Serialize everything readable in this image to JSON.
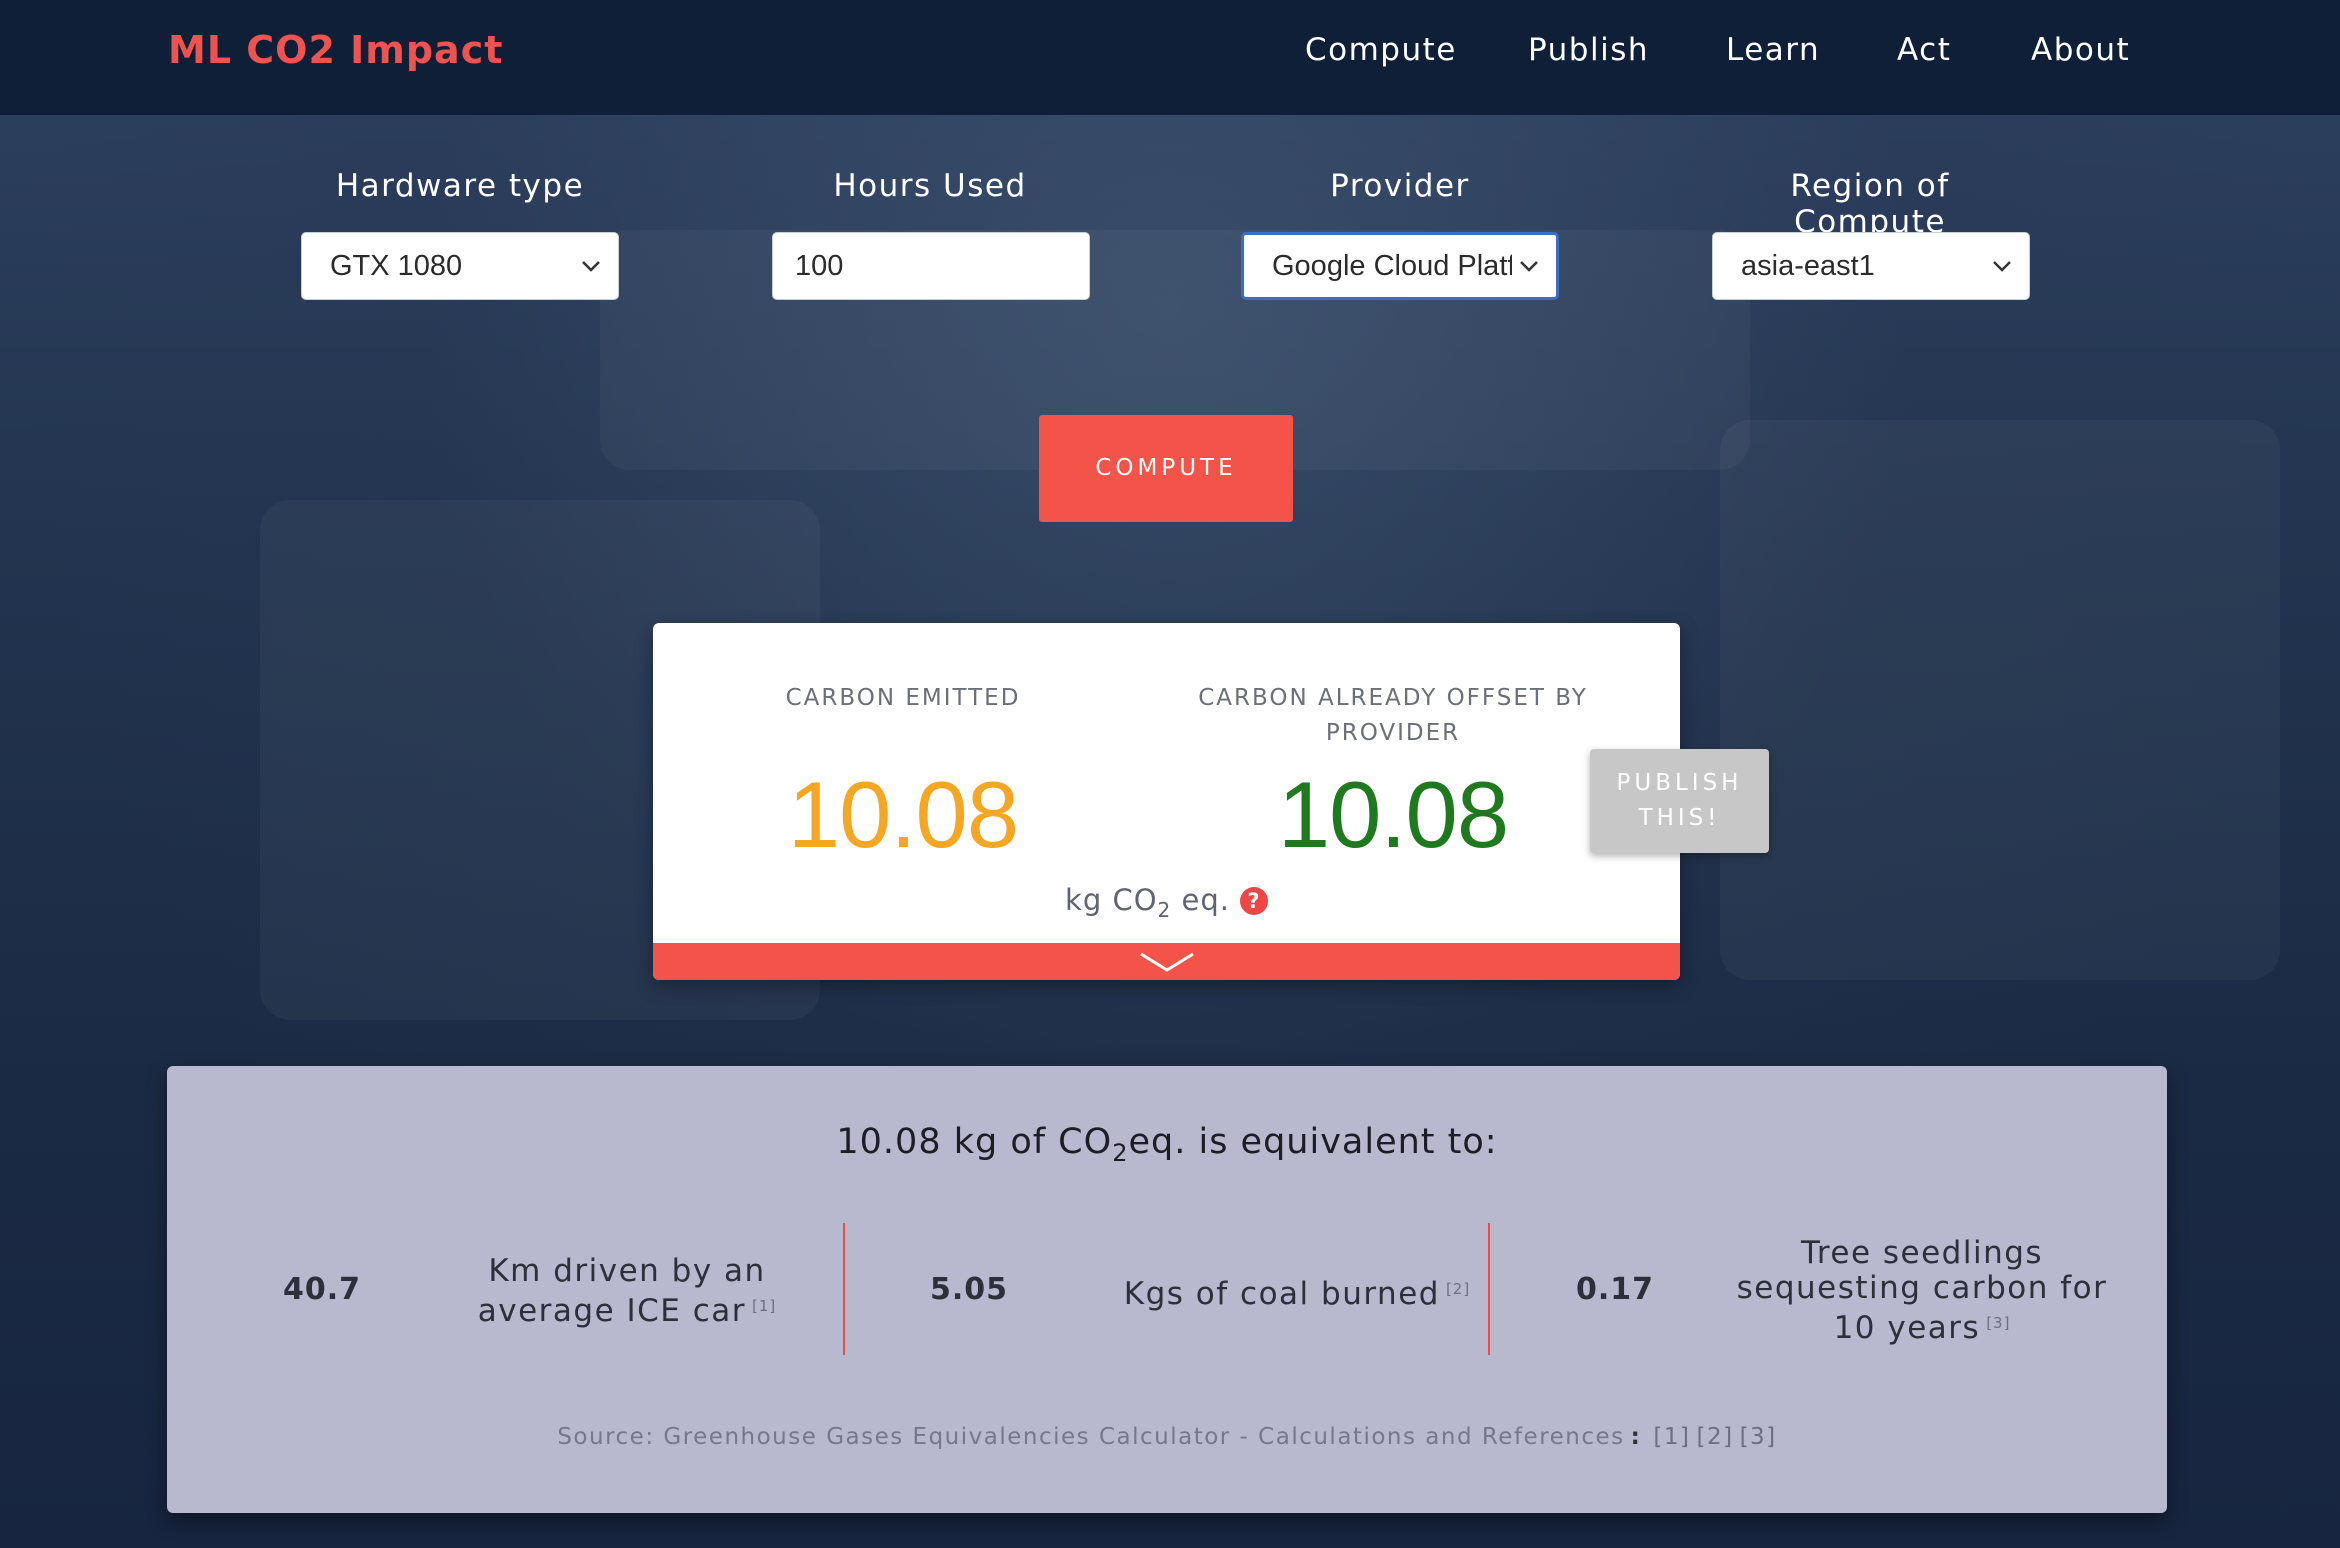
{
  "brand": "ML CO2 Impact",
  "nav": {
    "items": [
      {
        "label": "Compute"
      },
      {
        "label": "Publish"
      },
      {
        "label": "Learn"
      },
      {
        "label": "Act"
      },
      {
        "label": "About"
      }
    ]
  },
  "form": {
    "hardware": {
      "label": "Hardware type",
      "value": "GTX 1080"
    },
    "hours": {
      "label": "Hours Used",
      "value": "100"
    },
    "provider": {
      "label": "Provider",
      "value": "Google Cloud Platform"
    },
    "region": {
      "label": "Region of Compute",
      "value": "asia-east1"
    }
  },
  "compute_label": "COMPUTE",
  "result": {
    "emitted_label": "CARBON EMITTED",
    "emitted_value": "10.08",
    "offset_label_line1": "CARBON ALREADY OFFSET BY",
    "offset_label_line2": "PROVIDER",
    "offset_value": "10.08",
    "unit_prefix": "kg CO",
    "unit_sub": "2",
    "unit_suffix": " eq.",
    "help_glyph": "?"
  },
  "publish": {
    "line1": "PUBLISH",
    "line2": "THIS!"
  },
  "equivalence": {
    "title_prefix": "10.08 kg of CO",
    "title_sub": "2",
    "title_suffix": "eq. is equivalent to:",
    "items": [
      {
        "value": "40.7",
        "line1": "Km driven by an",
        "line2": "average ICE car",
        "ref": "[1]"
      },
      {
        "value": "5.05",
        "line1": "Kgs of coal burned",
        "ref": "[2]"
      },
      {
        "value": "0.17",
        "line1": "Tree seedlings",
        "line2": "sequesting carbon for",
        "line3": "10 years",
        "ref": "[3]"
      }
    ],
    "source_text": "Source: Greenhouse Gases Equivalencies Calculator - Calculations and References",
    "source_colon": ":",
    "source_links": [
      "[1]",
      "[2]",
      "[3]"
    ]
  },
  "colors": {
    "accent": "#f4534a",
    "emitted": "#f5a623",
    "offset": "#1f7a1f",
    "nav_bg": "#0f1f38"
  },
  "icons": {
    "select_arrow": "chevron-down-icon",
    "card_expand": "chevron-down-icon",
    "help": "question-circle-icon"
  }
}
